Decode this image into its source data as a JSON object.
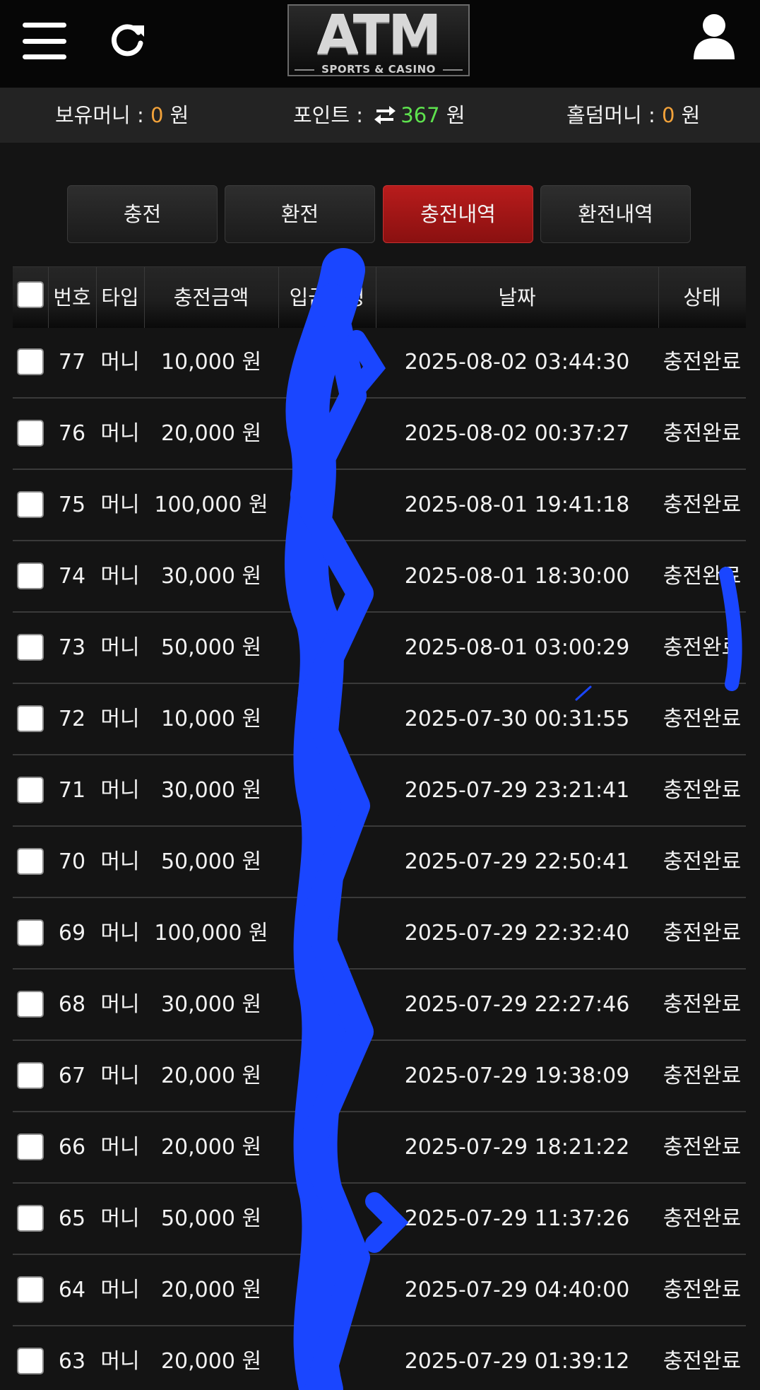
{
  "header": {
    "logo_main": "ATM",
    "logo_sub": "SPORTS & CASINO",
    "icons": [
      "menu-icon",
      "refresh-icon",
      "user-icon"
    ]
  },
  "balance": {
    "money_label": "보유머니 : ",
    "money_value": "0",
    "money_unit": " 원",
    "point_label": "포인트 : ",
    "point_value": "367",
    "point_unit": " 원",
    "holdem_label": "홀덤머니 : ",
    "holdem_value": "0",
    "holdem_unit": " 원"
  },
  "tabs": [
    {
      "label": "충전"
    },
    {
      "label": "환전"
    },
    {
      "label": "충전내역",
      "active": true
    },
    {
      "label": "환전내역"
    }
  ],
  "table": {
    "headers": {
      "no": "번호",
      "type": "타입",
      "amount": "충전금액",
      "depositor": "입금자명",
      "date": "날짜",
      "status": "상태"
    },
    "rows": [
      {
        "no": "77",
        "type": "머니",
        "amount": "10,000 원",
        "depositor": "",
        "date": "2025-08-02 03:44:30",
        "status": "충전완료"
      },
      {
        "no": "76",
        "type": "머니",
        "amount": "20,000 원",
        "depositor": "",
        "date": "2025-08-02 00:37:27",
        "status": "충전완료"
      },
      {
        "no": "75",
        "type": "머니",
        "amount": "100,000 원",
        "depositor": "",
        "date": "2025-08-01 19:41:18",
        "status": "충전완료"
      },
      {
        "no": "74",
        "type": "머니",
        "amount": "30,000 원",
        "depositor": "",
        "date": "2025-08-01 18:30:00",
        "status": "충전완료"
      },
      {
        "no": "73",
        "type": "머니",
        "amount": "50,000 원",
        "depositor": "",
        "date": "2025-08-01 03:00:29",
        "status": "충전완료"
      },
      {
        "no": "72",
        "type": "머니",
        "amount": "10,000 원",
        "depositor": "",
        "date": "2025-07-30 00:31:55",
        "status": "충전완료"
      },
      {
        "no": "71",
        "type": "머니",
        "amount": "30,000 원",
        "depositor": "",
        "date": "2025-07-29 23:21:41",
        "status": "충전완료"
      },
      {
        "no": "70",
        "type": "머니",
        "amount": "50,000 원",
        "depositor": "",
        "date": "2025-07-29 22:50:41",
        "status": "충전완료"
      },
      {
        "no": "69",
        "type": "머니",
        "amount": "100,000 원",
        "depositor": "",
        "date": "2025-07-29 22:32:40",
        "status": "충전완료"
      },
      {
        "no": "68",
        "type": "머니",
        "amount": "30,000 원",
        "depositor": "",
        "date": "2025-07-29 22:27:46",
        "status": "충전완료"
      },
      {
        "no": "67",
        "type": "머니",
        "amount": "20,000 원",
        "depositor": "",
        "date": "2025-07-29 19:38:09",
        "status": "충전완료"
      },
      {
        "no": "66",
        "type": "머니",
        "amount": "20,000 원",
        "depositor": "",
        "date": "2025-07-29 18:21:22",
        "status": "충전완료"
      },
      {
        "no": "65",
        "type": "머니",
        "amount": "50,000 원",
        "depositor": "",
        "date": "2025-07-29 11:37:26",
        "status": "충전완료"
      },
      {
        "no": "64",
        "type": "머니",
        "amount": "20,000 원",
        "depositor": "",
        "date": "2025-07-29 04:40:00",
        "status": "충전완료"
      },
      {
        "no": "63",
        "type": "머니",
        "amount": "20,000 원",
        "depositor": "",
        "date": "2025-07-29 01:39:12",
        "status": "충전완료"
      }
    ]
  },
  "colors": {
    "background": "#141414",
    "header": "#060606",
    "balance_bar": "#232323",
    "active_tab": "#a81818",
    "orange": "#f2a23a",
    "green": "#5ee24e",
    "redaction": "#1a46ff"
  }
}
